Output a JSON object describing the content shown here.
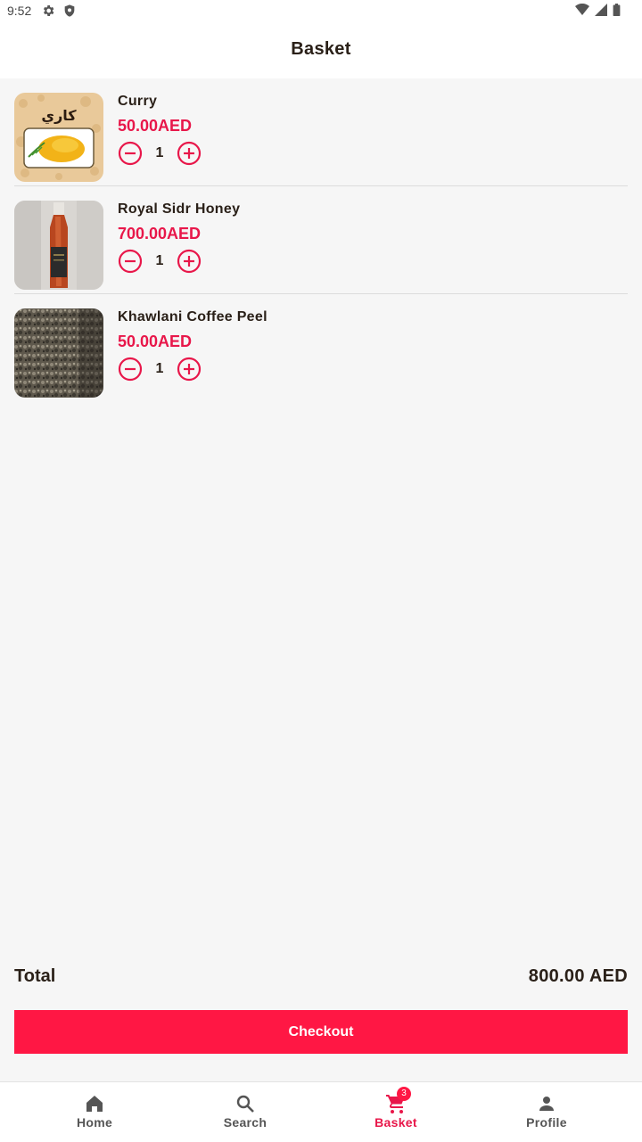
{
  "status_bar": {
    "time": "9:52"
  },
  "header": {
    "title": "Basket"
  },
  "basket": {
    "items": [
      {
        "name": "Curry",
        "price": "50.00AED",
        "quantity": "1",
        "thumb_text": "كاري"
      },
      {
        "name": "Royal Sidr Honey",
        "price": "700.00AED",
        "quantity": "1"
      },
      {
        "name": "Khawlani Coffee Peel",
        "price": "50.00AED",
        "quantity": "1"
      }
    ]
  },
  "summary": {
    "total_label": "Total",
    "total_value": "800.00 AED",
    "checkout_label": "Checkout"
  },
  "bottom_nav": {
    "items": [
      {
        "label": "Home",
        "icon": "home-icon"
      },
      {
        "label": "Search",
        "icon": "search-icon"
      },
      {
        "label": "Basket",
        "icon": "cart-icon",
        "badge": "3",
        "active": true
      },
      {
        "label": "Profile",
        "icon": "person-icon"
      }
    ]
  },
  "colors": {
    "accent": "#ff1744",
    "price": "#e8174a",
    "text": "#2a2018",
    "background": "#f6f6f6"
  }
}
